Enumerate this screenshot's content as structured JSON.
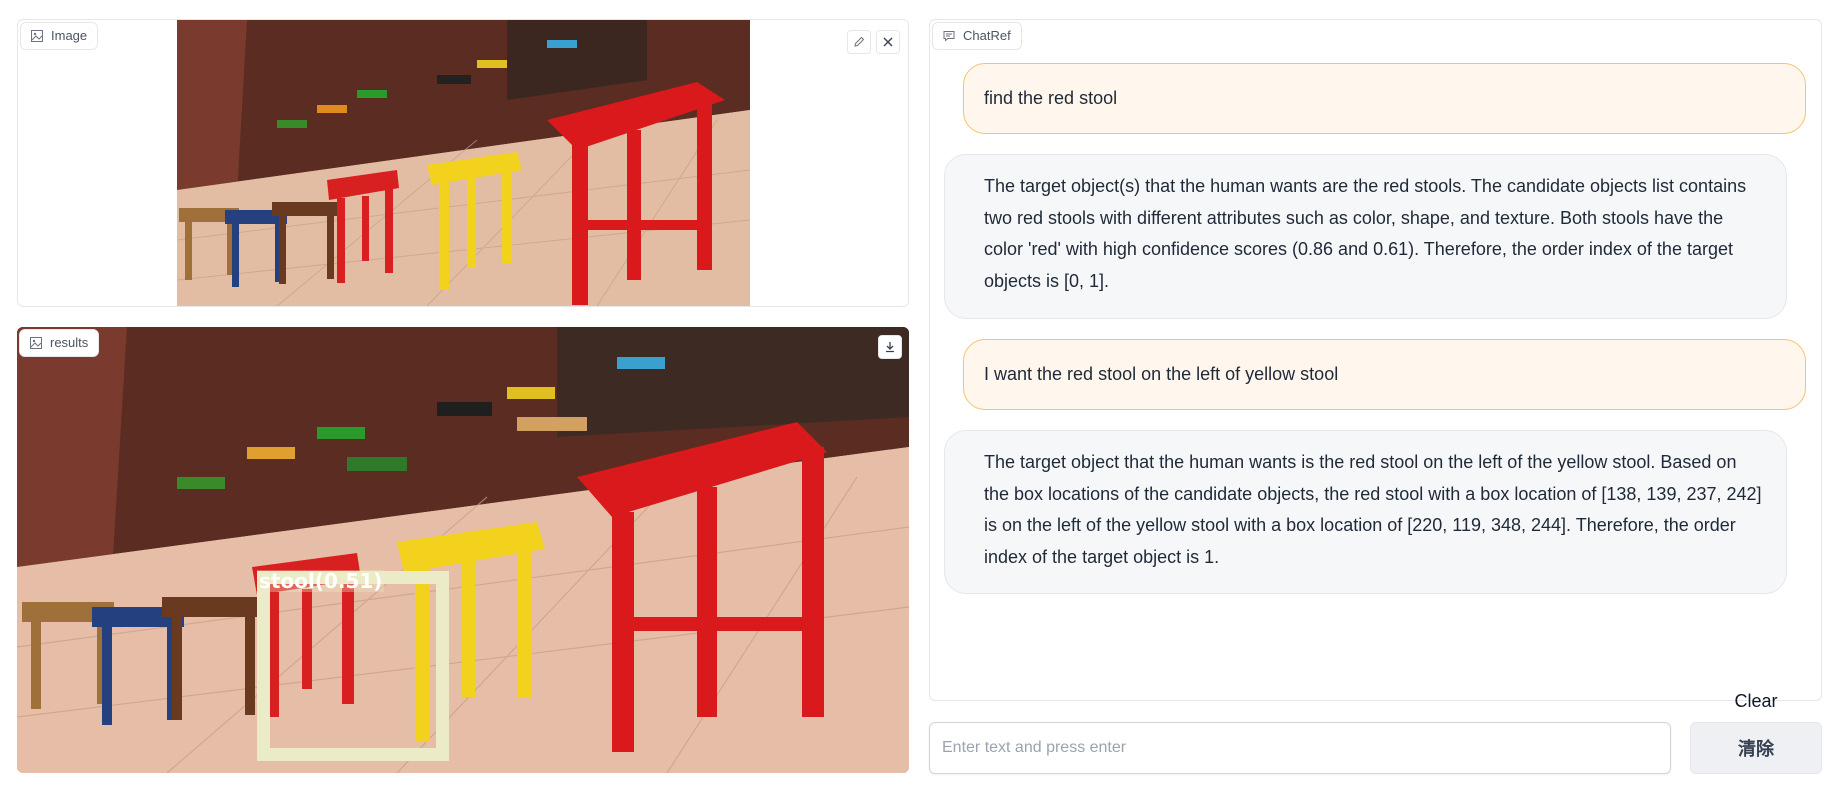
{
  "image_panel": {
    "label": "Image",
    "label_icon": "image-icon",
    "edit_icon": "pencil-icon",
    "close_icon": "close-icon"
  },
  "results_panel": {
    "label": "results",
    "label_icon": "image-icon",
    "download_icon": "download-icon",
    "detection": {
      "label": "stool(0.51)",
      "color": "#ecebc7"
    }
  },
  "chat_panel": {
    "label": "ChatRef",
    "label_icon": "chat-icon",
    "messages": [
      {
        "role": "user",
        "text": "find the red stool"
      },
      {
        "role": "bot",
        "text": "The target object(s) that the human wants are the red stools. The candidate objects list contains two red stools with different attributes such as color, shape, and texture. Both stools have the color 'red' with high confidence scores (0.86 and 0.61). Therefore, the order index of the target objects is [0, 1]."
      },
      {
        "role": "user",
        "text": "I want the red stool on the left of yellow stool"
      },
      {
        "role": "bot",
        "text": "The target object that the human wants is the red stool on the left of the yellow stool. Based on the box locations of the candidate objects, the red stool with a box location of [138, 139, 237, 242] is on the left of the yellow stool with a box location of [220, 119, 348, 244]. Therefore, the order index of the target object is 1."
      }
    ]
  },
  "input": {
    "placeholder": "Enter text and press enter",
    "value": ""
  },
  "clear": {
    "caption": "Clear",
    "button_label": "清除"
  },
  "colors": {
    "user_bubble_bg": "#fff7ed",
    "user_bubble_border": "#f3c46b",
    "bot_bubble_bg": "#f6f7f9"
  }
}
